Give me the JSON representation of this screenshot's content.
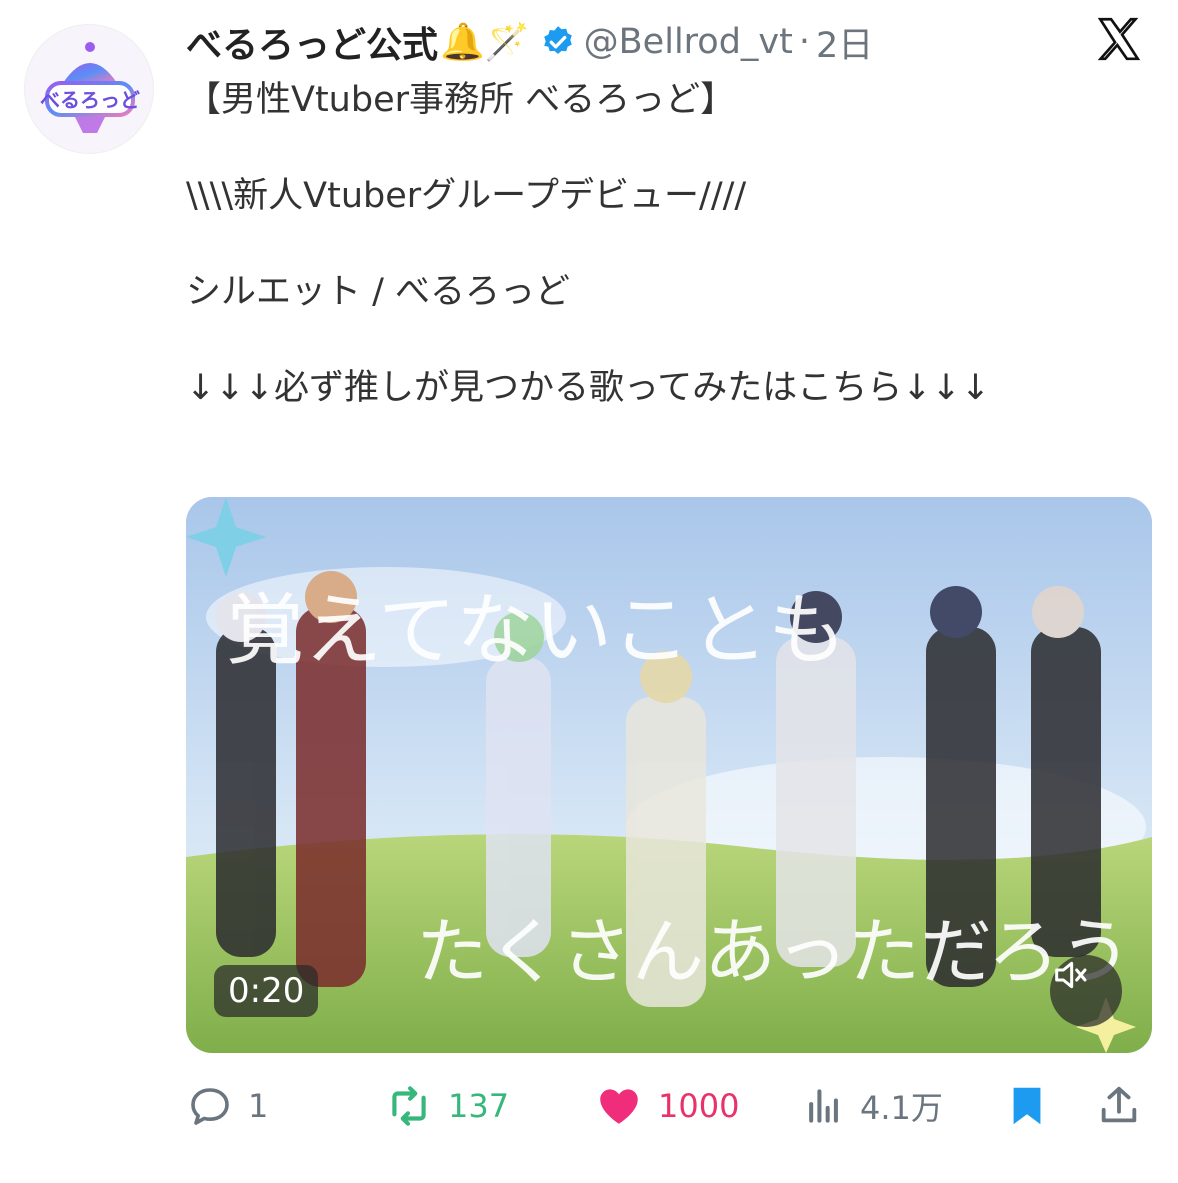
{
  "author": {
    "display_name": "べるろっど公式",
    "emoji": "🔔🪄",
    "handle": "@Bellrod_vt",
    "separator": "·",
    "time": "2日",
    "avatar_text": "べるろっど"
  },
  "post": {
    "lines": [
      "【男性Vtuber事務所 べるろっど】",
      "",
      "\\\\\\\\新人Vtuberグループデビュー////",
      "",
      "シルエット / べるろっど",
      "",
      "↓↓↓必ず推しが見つかる歌ってみたはこちら↓↓↓"
    ]
  },
  "media": {
    "type": "video",
    "duration": "0:20",
    "lyrics_line1": "覚えてないことも",
    "lyrics_line2": "たくさんあっただろう"
  },
  "actions": {
    "replies": "1",
    "reposts": "137",
    "likes": "1000",
    "views": "4.1万"
  },
  "colors": {
    "verified": "#1d9bf0",
    "repost": "#37b77c",
    "like": "#e8326a",
    "bookmark": "#1d9bf0"
  },
  "icons": [
    "verified-badge-icon",
    "x-logo-icon",
    "mute-icon",
    "reply-icon",
    "repost-icon",
    "like-icon",
    "views-icon",
    "bookmark-icon",
    "share-icon"
  ]
}
